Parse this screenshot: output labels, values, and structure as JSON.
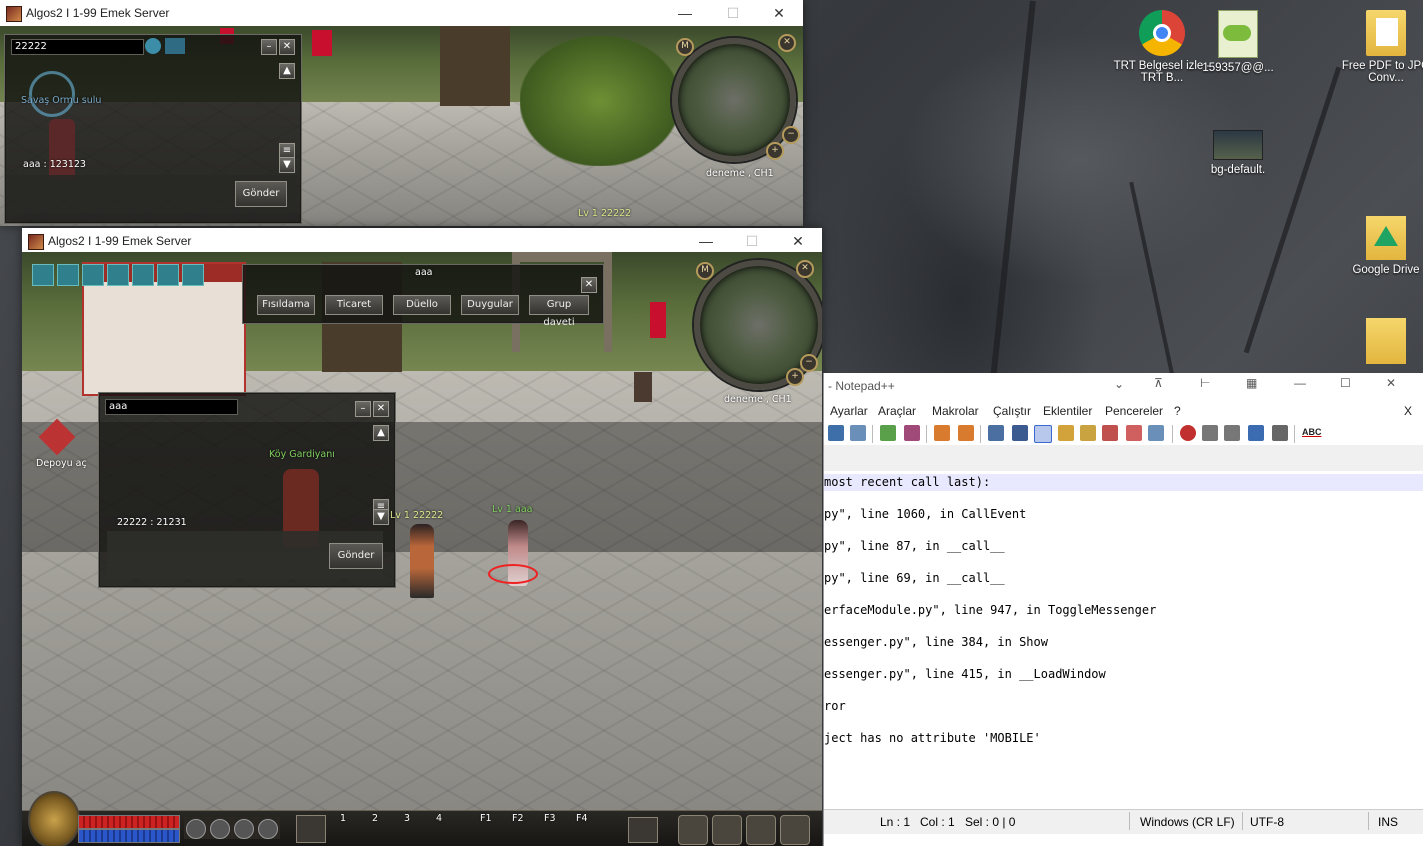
{
  "desktop": {
    "icons": [
      {
        "label": "TRT Belgesel izle - TRT B...",
        "icon": "chrome-icon"
      },
      {
        "label": "159357@@...",
        "icon": "notepadpp-file-icon"
      },
      {
        "label": "Free PDF to JPG Conv...",
        "icon": "folder-pdf-icon"
      },
      {
        "label": "bg-default.",
        "icon": "image-thumbnail-icon"
      },
      {
        "label": "Google Drive",
        "icon": "google-drive-icon"
      },
      {
        "label": "",
        "icon": "folder-icon"
      }
    ]
  },
  "game1": {
    "title": "Algos2 I 1-99 Emek Server",
    "chat": {
      "input_value": "22222",
      "npc_label": "Savaş Ormu sulu",
      "message": "aaa : 123123",
      "send_label": "Gönder"
    },
    "minimap": {
      "channel": "deneme , CH1"
    },
    "player_label": "Lv 1 22222"
  },
  "game2": {
    "title": "Algos2 I 1-99 Emek Server",
    "target": {
      "name": "aaa",
      "buttons": [
        "Fısıldama",
        "Ticaret",
        "Düello",
        "Duygular",
        "Grup daveti"
      ]
    },
    "chat": {
      "input_value": "aaa",
      "npc_label": "Köy Gardiyanı",
      "message": "22222 : 21231",
      "send_label": "Gönder"
    },
    "npc_storage": "Depoyu aç",
    "minimap": {
      "channel": "deneme , CH1"
    },
    "player_label": "Lv 1 22222",
    "other_player_label": "Lv 1 aaa",
    "hotbar_slots": [
      "1",
      "2",
      "3",
      "4",
      "F1",
      "F2",
      "F3",
      "F4"
    ]
  },
  "notepad": {
    "title": "- Notepad++",
    "menu": [
      "Ayarlar",
      "Araçlar",
      "Makrolar",
      "Çalıştır",
      "Eklentiler",
      "Pencereler",
      "?"
    ],
    "menu_close": "X",
    "lines": [
      "most recent call last):",
      "py\", line 1060, in CallEvent",
      "py\", line 87, in __call__",
      "py\", line 69, in __call__",
      "erfaceModule.py\", line 947, in ToggleMessenger",
      "essenger.py\", line 384, in Show",
      "essenger.py\", line 415, in __LoadWindow",
      "ror",
      "ject has no attribute 'MOBILE'"
    ],
    "status": {
      "ln": "Ln : 1",
      "col": "Col : 1",
      "sel": "Sel : 0 | 0",
      "eol": "Windows (CR LF)",
      "encoding": "UTF-8",
      "mode": "INS"
    },
    "toolbar_abc": "ABC"
  },
  "colors": {
    "titlebar_bg": "#ffffff",
    "game_panel_bg": "#121210",
    "npc_name_green": "#7fcf5f",
    "notepad_current_line": "#e8e8ff"
  }
}
